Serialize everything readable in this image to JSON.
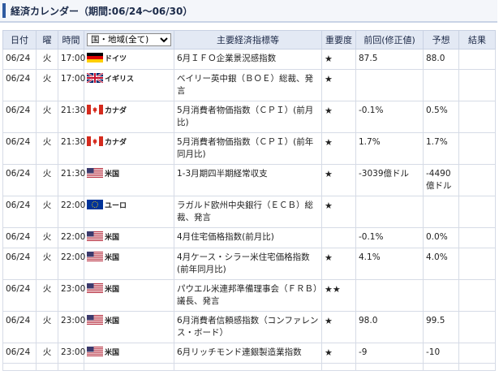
{
  "header": {
    "title": "経済カレンダー（期間:06/24～06/30）"
  },
  "columns": {
    "date": "日付",
    "weekday": "曜",
    "time": "時間",
    "region_select": "国・地域(全て)",
    "indicator": "主要経済指標等",
    "importance": "重要度",
    "previous": "前回(修正値)",
    "forecast": "予想",
    "result": "結果"
  },
  "rows": [
    {
      "date": "06/24",
      "weekday": "火",
      "time": "17:00",
      "flag": "de",
      "country": "ドイツ",
      "indicator": "6月ＩＦＯ企業景況感指数",
      "importance": "★",
      "previous": "87.5",
      "forecast": "88.0",
      "result": ""
    },
    {
      "date": "06/24",
      "weekday": "火",
      "time": "17:00",
      "flag": "gb",
      "country": "イギリス",
      "indicator": "ベイリー英中銀（ＢＯＥ）総裁、発言",
      "importance": "★",
      "previous": "",
      "forecast": "",
      "result": ""
    },
    {
      "date": "06/24",
      "weekday": "火",
      "time": "21:30",
      "flag": "ca",
      "country": "カナダ",
      "indicator": "5月消費者物価指数（ＣＰＩ）(前月比)",
      "importance": "★",
      "previous": "-0.1%",
      "forecast": "0.5%",
      "result": ""
    },
    {
      "date": "06/24",
      "weekday": "火",
      "time": "21:30",
      "flag": "ca",
      "country": "カナダ",
      "indicator": "5月消費者物価指数（ＣＰＩ）(前年同月比)",
      "importance": "★",
      "previous": "1.7%",
      "forecast": "1.7%",
      "result": ""
    },
    {
      "date": "06/24",
      "weekday": "火",
      "time": "21:30",
      "flag": "us",
      "country": "米国",
      "indicator": "1-3月期四半期経常収支",
      "importance": "★",
      "previous": "-3039億ドル",
      "forecast": "-4490億ドル",
      "result": ""
    },
    {
      "date": "06/24",
      "weekday": "火",
      "time": "22:00",
      "flag": "eu",
      "country": "ユーロ",
      "indicator": "ラガルド欧州中央銀行（ＥＣＢ）総裁、発言",
      "importance": "★",
      "previous": "",
      "forecast": "",
      "result": ""
    },
    {
      "date": "06/24",
      "weekday": "火",
      "time": "22:00",
      "flag": "us",
      "country": "米国",
      "indicator": "4月住宅価格指数(前月比)",
      "importance": "",
      "previous": "-0.1%",
      "forecast": "0.0%",
      "result": ""
    },
    {
      "date": "06/24",
      "weekday": "火",
      "time": "22:00",
      "flag": "us",
      "country": "米国",
      "indicator": "4月ケース・シラー米住宅価格指数(前年同月比)",
      "importance": "★",
      "previous": "4.1%",
      "forecast": "4.0%",
      "result": ""
    },
    {
      "date": "06/24",
      "weekday": "火",
      "time": "23:00",
      "flag": "us",
      "country": "米国",
      "indicator": "パウエル米連邦準備理事会（ＦＲＢ）議長、発言",
      "importance": "★★",
      "previous": "",
      "forecast": "",
      "result": ""
    },
    {
      "date": "06/24",
      "weekday": "火",
      "time": "23:00",
      "flag": "us",
      "country": "米国",
      "indicator": "6月消費者信頼感指数（コンファレンス・ボード）",
      "importance": "★",
      "previous": "98.0",
      "forecast": "99.5",
      "result": ""
    },
    {
      "date": "06/24",
      "weekday": "火",
      "time": "23:00",
      "flag": "us",
      "country": "米国",
      "indicator": "6月リッチモンド連銀製造業指数",
      "importance": "★",
      "previous": "-9",
      "forecast": "-10",
      "result": ""
    },
    {
      "date": "",
      "weekday": "",
      "time": "",
      "flag": "",
      "country": "",
      "indicator": "",
      "importance": "",
      "previous": "",
      "forecast": "",
      "result": ""
    }
  ],
  "colors": {
    "title_accent": "#2f5aa0",
    "header_bg": "#e3e9f4"
  }
}
